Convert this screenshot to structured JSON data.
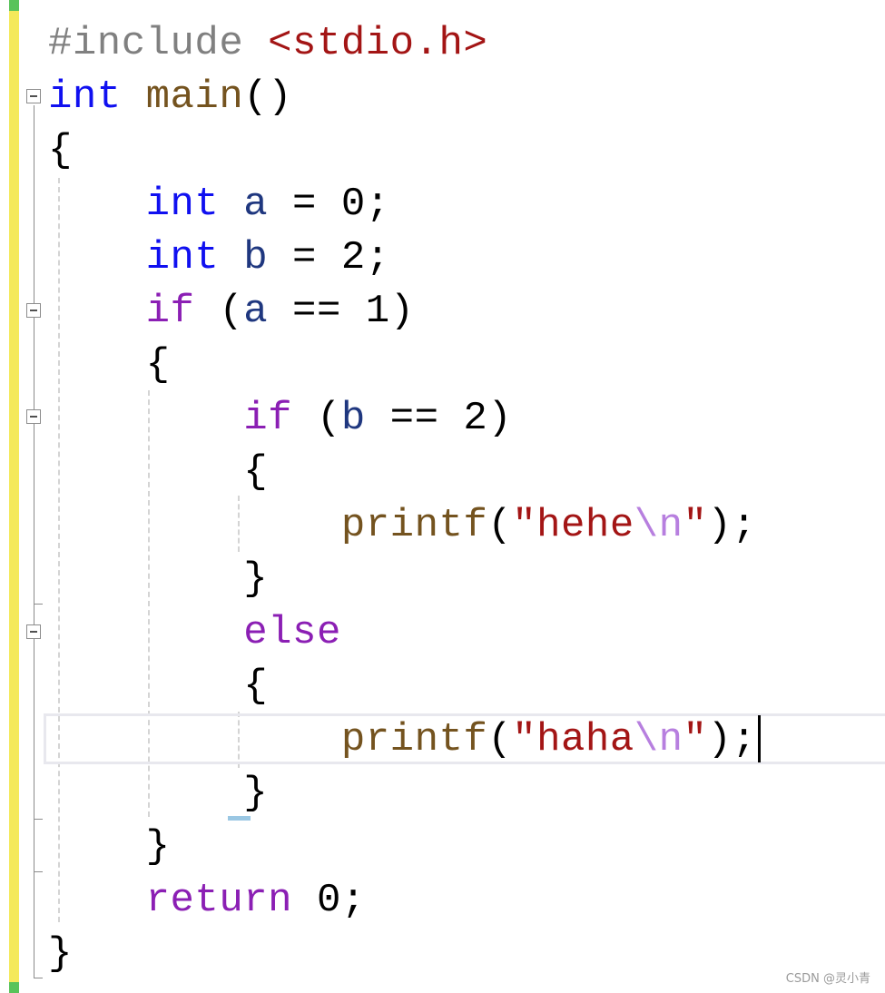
{
  "code": {
    "line1": {
      "directive": "#include",
      "header": "<stdio.h>"
    },
    "line2": {
      "type": "int",
      "func": "main",
      "parens": "()"
    },
    "line3": {
      "text": "{"
    },
    "line4": {
      "type": "int",
      "var": "a",
      "rest": " = 0;"
    },
    "line5": {
      "type": "int",
      "var": "b",
      "rest": " = 2;"
    },
    "line6": {
      "keyword": "if",
      "open": " (",
      "var": "a",
      "rest": " == 1)"
    },
    "line7": {
      "text": "{"
    },
    "line8": {
      "keyword": "if",
      "open": " (",
      "var": "b",
      "rest": " == 2)"
    },
    "line9": {
      "text": "{"
    },
    "line10": {
      "func": "printf",
      "open": "(",
      "quote_open": "\"",
      "str": "hehe",
      "esc": "\\n",
      "quote_close": "\"",
      "close": ");"
    },
    "line11": {
      "text": "}"
    },
    "line12": {
      "keyword": "else"
    },
    "line13": {
      "text": "{"
    },
    "line14": {
      "func": "printf",
      "open": "(",
      "quote_open": "\"",
      "str": "haha",
      "esc": "\\n",
      "quote_close": "\"",
      "close": ");"
    },
    "line15": {
      "text": "}"
    },
    "line16": {
      "text": "}"
    },
    "line17": {
      "keyword": "return",
      "rest": " 0;"
    },
    "line18": {
      "text": "}"
    }
  },
  "watermark": "CSDN @灵小青",
  "colors": {
    "keyword": "#1010f0",
    "control": "#8b1fb4",
    "function": "#74531f",
    "variable": "#1f377f",
    "string": "#a31515",
    "escape": "#b77fdf",
    "change_bar": "#f4e95a",
    "saved_bar": "#58c35a"
  },
  "icons": [
    "collapse-icon"
  ]
}
